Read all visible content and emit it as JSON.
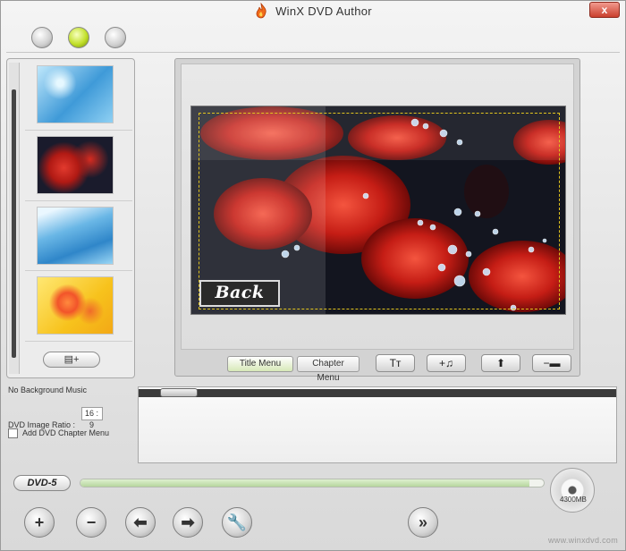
{
  "window": {
    "title": "WinX DVD Author",
    "close_label": "x"
  },
  "side_panel": {
    "add_menu_label": "▤+"
  },
  "preview": {
    "back_button_label": "Back"
  },
  "tabs": [
    {
      "label": "Title Menu",
      "active": true
    },
    {
      "label": "Chapter Menu",
      "active": false
    }
  ],
  "tools": {
    "text": "Tт",
    "add_music": "+♫",
    "up": "⬆",
    "remove": "−▬"
  },
  "options": {
    "background_music": "No Background Music",
    "image_ratio_label": "DVD Image Ratio :",
    "image_ratio_value": "16 : 9",
    "chapter_menu_label": "Add DVD Chapter Menu",
    "chapter_menu_checked": false
  },
  "capacity": {
    "disc_type": "DVD-5",
    "disc_size": "4300MB",
    "used_fraction": 0.97
  },
  "bottom_buttons": {
    "add": "+",
    "remove": "−",
    "back": "⬅",
    "forward": "➡",
    "settings": "🔧",
    "next": "»"
  },
  "watermark": "www.winxdvd.com",
  "colors": {
    "active_orb": "#c2e02a",
    "safe_area": "#e1c41e",
    "close": "#c9402e"
  }
}
